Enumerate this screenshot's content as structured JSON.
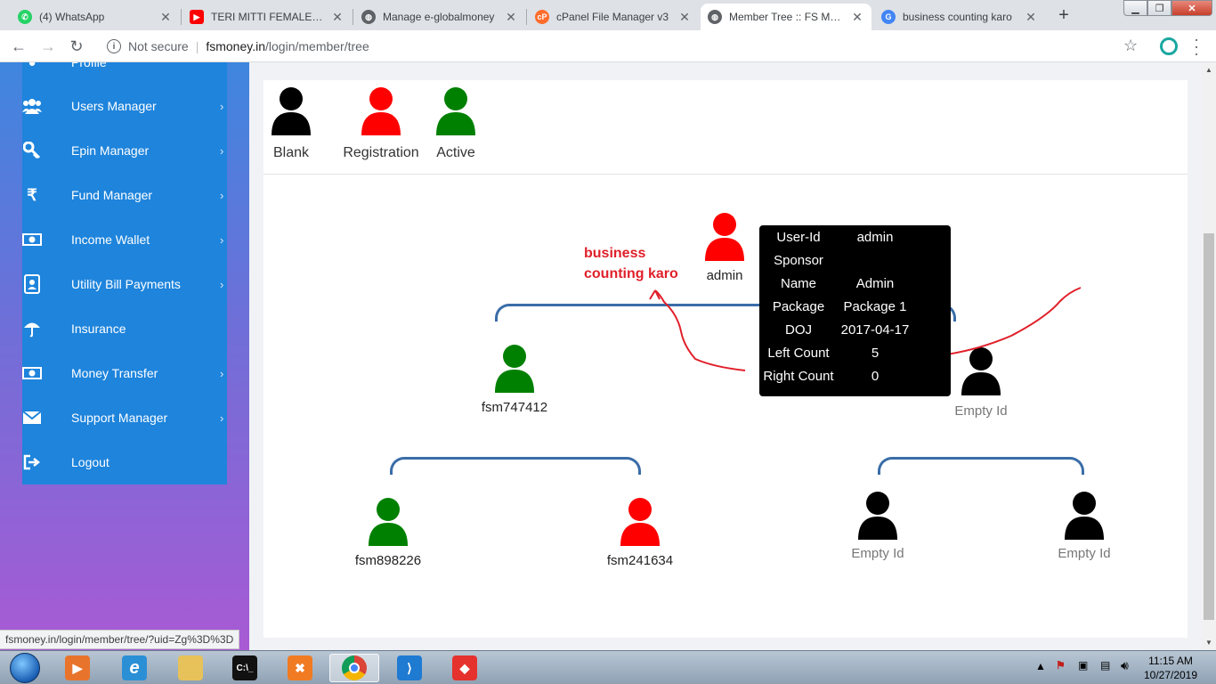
{
  "browser": {
    "tabs": [
      {
        "title": "(4) WhatsApp",
        "favicon_color": "#25d366"
      },
      {
        "title": "TERI MITTI FEMALE VERS",
        "favicon_color": "#ff0000"
      },
      {
        "title": "Manage e-globalmoney",
        "favicon_color": "#5f6368"
      },
      {
        "title": "cPanel File Manager v3",
        "favicon_color": "#ff6c2c"
      },
      {
        "title": "Member Tree :: FS Mone",
        "favicon_color": "#5f6368"
      },
      {
        "title": "business counting karo",
        "favicon_color": "#4285f4"
      }
    ],
    "new_tab": "+",
    "address": {
      "security_label": "Not secure",
      "host": "fsmoney.in",
      "path": "/login/member/tree"
    },
    "status_url": "fsmoney.in/login/member/tree/?uid=Zg%3D%3D"
  },
  "sidebar": {
    "items": [
      {
        "label": "Profile",
        "icon": "user-icon",
        "chevron": false
      },
      {
        "label": "Users Manager",
        "icon": "users-icon",
        "chevron": true
      },
      {
        "label": "Epin Manager",
        "icon": "key-icon",
        "chevron": true
      },
      {
        "label": "Fund Manager",
        "icon": "rupee-icon",
        "chevron": true
      },
      {
        "label": "Income Wallet",
        "icon": "money-icon",
        "chevron": true
      },
      {
        "label": "Utility Bill Payments",
        "icon": "bill-icon",
        "chevron": true
      },
      {
        "label": "Insurance",
        "icon": "umbrella-icon",
        "chevron": false
      },
      {
        "label": "Money Transfer",
        "icon": "money-icon",
        "chevron": true
      },
      {
        "label": "Support Manager",
        "icon": "envelope-icon",
        "chevron": true
      },
      {
        "label": "Logout",
        "icon": "logout-icon",
        "chevron": false
      }
    ]
  },
  "legend": [
    {
      "label": "Blank",
      "color": "#000000"
    },
    {
      "label": "Registration",
      "color": "#ff0000"
    },
    {
      "label": "Active",
      "color": "#008000"
    }
  ],
  "tree": {
    "root": {
      "label": "admin",
      "color": "#ff0000"
    },
    "level1": [
      {
        "label": "fsm747412",
        "color": "#008000"
      },
      {
        "label": "Empty Id",
        "color": "#000000"
      }
    ],
    "level2": [
      {
        "label": "fsm898226",
        "color": "#008000"
      },
      {
        "label": "fsm241634",
        "color": "#ff0000"
      },
      {
        "label": "Empty Id",
        "color": "#000000"
      },
      {
        "label": "Empty Id",
        "color": "#000000"
      }
    ]
  },
  "tooltip": {
    "rows": [
      {
        "key": "User-Id",
        "value": "admin"
      },
      {
        "key": "Sponsor",
        "value": ""
      },
      {
        "key": "Name",
        "value": "Admin"
      },
      {
        "key": "Package",
        "value": "Package 1"
      },
      {
        "key": "DOJ",
        "value": "2017-04-17"
      },
      {
        "key": "Left Count",
        "value": "5"
      },
      {
        "key": "Right Count",
        "value": "0"
      }
    ]
  },
  "annotation": {
    "line1": "business",
    "line2": "counting karo",
    "color": "#e0202a"
  },
  "taskbar": {
    "apps": [
      {
        "name": "media-player-icon",
        "color": "#e8742c"
      },
      {
        "name": "internet-explorer-icon",
        "color": "#2b8fd6"
      },
      {
        "name": "file-explorer-icon",
        "color": "#e7c15a"
      },
      {
        "name": "command-prompt-icon",
        "color": "#111111"
      },
      {
        "name": "xampp-icon",
        "color": "#f07b22"
      },
      {
        "name": "chrome-icon",
        "color": "#4285f4"
      },
      {
        "name": "vscode-icon",
        "color": "#1f7ad1"
      },
      {
        "name": "anydesk-icon",
        "color": "#e5322d"
      }
    ],
    "time": "11:15 AM",
    "date": "10/27/2019"
  }
}
